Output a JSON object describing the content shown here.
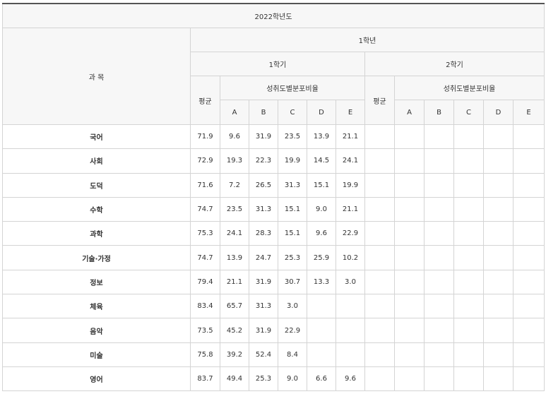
{
  "year_label": "2022학년도",
  "subject_header": "과 목",
  "grade_label": "1학년",
  "semesters": [
    {
      "label": "1학기",
      "avg_label": "평균",
      "dist_label": "성취도별분포비율"
    },
    {
      "label": "2학기",
      "avg_label": "평균",
      "dist_label": "성취도별분포비율"
    }
  ],
  "levels": [
    "A",
    "B",
    "C",
    "D",
    "E"
  ],
  "rows": [
    {
      "subject": "국어",
      "avg": "71.9",
      "dist": [
        "9.6",
        "31.9",
        "23.5",
        "13.9",
        "21.1"
      ]
    },
    {
      "subject": "사회",
      "avg": "72.9",
      "dist": [
        "19.3",
        "22.3",
        "19.9",
        "14.5",
        "24.1"
      ]
    },
    {
      "subject": "도덕",
      "avg": "71.6",
      "dist": [
        "7.2",
        "26.5",
        "31.3",
        "15.1",
        "19.9"
      ]
    },
    {
      "subject": "수학",
      "avg": "74.7",
      "dist": [
        "23.5",
        "31.3",
        "15.1",
        "9.0",
        "21.1"
      ]
    },
    {
      "subject": "과학",
      "avg": "75.3",
      "dist": [
        "24.1",
        "28.3",
        "15.1",
        "9.6",
        "22.9"
      ]
    },
    {
      "subject": "기술·가정",
      "avg": "74.7",
      "dist": [
        "13.9",
        "24.7",
        "25.3",
        "25.9",
        "10.2"
      ]
    },
    {
      "subject": "정보",
      "avg": "79.4",
      "dist": [
        "21.1",
        "31.9",
        "30.7",
        "13.3",
        "3.0"
      ]
    },
    {
      "subject": "체육",
      "avg": "83.4",
      "dist": [
        "65.7",
        "31.3",
        "3.0",
        "",
        ""
      ]
    },
    {
      "subject": "음악",
      "avg": "73.5",
      "dist": [
        "45.2",
        "31.9",
        "22.9",
        "",
        ""
      ]
    },
    {
      "subject": "미술",
      "avg": "75.8",
      "dist": [
        "39.2",
        "52.4",
        "8.4",
        "",
        ""
      ]
    },
    {
      "subject": "영어",
      "avg": "83.7",
      "dist": [
        "49.4",
        "25.3",
        "9.0",
        "6.6",
        "9.6"
      ]
    }
  ]
}
